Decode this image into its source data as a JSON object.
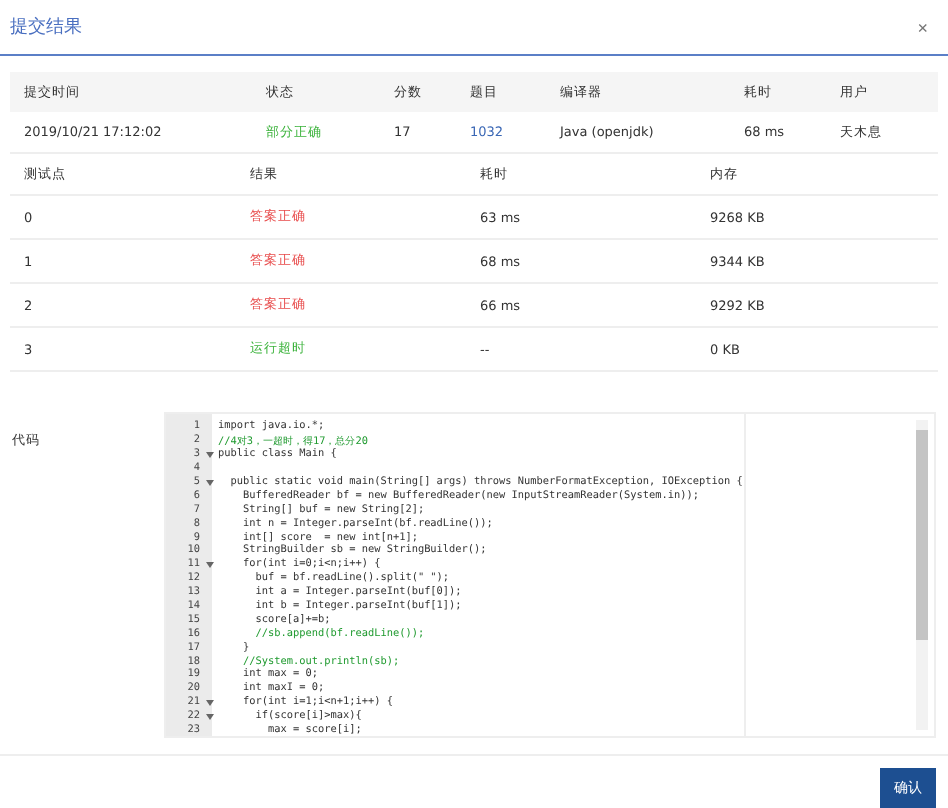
{
  "dialog": {
    "title": "提交结果",
    "close": "×"
  },
  "summary": {
    "columns": [
      "提交时间",
      "状态",
      "分数",
      "题目",
      "编译器",
      "耗时",
      "用户"
    ],
    "row": {
      "time": "2019/10/21 17:12:02",
      "status": "部分正确",
      "color": "#3cb33c",
      "score": "17",
      "problem": "1032",
      "compiler": "Java (openjdk)",
      "elapsed": "68 ms",
      "user": "天木息"
    }
  },
  "tests": {
    "columns": [
      "测试点",
      "结果",
      "耗时",
      "内存"
    ],
    "rows": [
      {
        "id": "0",
        "result": "答案正确",
        "color": "#e84c4c",
        "time": "63 ms",
        "memory": "9268 KB"
      },
      {
        "id": "1",
        "result": "答案正确",
        "color": "#e84c4c",
        "time": "68 ms",
        "memory": "9344 KB"
      },
      {
        "id": "2",
        "result": "答案正确",
        "color": "#e84c4c",
        "time": "66 ms",
        "memory": "9292 KB"
      },
      {
        "id": "3",
        "result": "运行超时",
        "color": "#3cb33c",
        "time": "--",
        "memory": "0 KB"
      }
    ]
  },
  "code": {
    "label": "代码",
    "lines": [
      {
        "number": "1",
        "fold": false,
        "comment": false,
        "text": "import java.io.*;"
      },
      {
        "number": "2",
        "fold": false,
        "comment": true,
        "text": "//4对3，一超时，得17，总分20"
      },
      {
        "number": "3",
        "fold": true,
        "comment": false,
        "text": "public class Main {"
      },
      {
        "number": "4",
        "fold": false
      },
      {
        "number": "5",
        "fold": true,
        "comment": false,
        "text": "  public static void main(String[] args) throws NumberFormatException, IOException {"
      },
      {
        "number": "6",
        "fold": false,
        "comment": false,
        "text": "    BufferedReader bf = new BufferedReader(new InputStreamReader(System.in));"
      },
      {
        "number": "7",
        "fold": false,
        "comment": false,
        "text": "    String[] buf = new String[2];"
      },
      {
        "number": "8",
        "fold": false,
        "comment": false,
        "text": "    int n = Integer.parseInt(bf.readLine());"
      },
      {
        "number": "9",
        "fold": false,
        "comment": false,
        "text": "    int[] score  = new int[n+1];"
      },
      {
        "number": "10",
        "fold": false,
        "comment": false,
        "text": "    StringBuilder sb = new StringBuilder();"
      },
      {
        "number": "11",
        "fold": true,
        "comment": false,
        "text": "    for(int i=0;i<n;i++) {"
      },
      {
        "number": "12",
        "fold": false,
        "comment": false,
        "text": "      buf = bf.readLine().split(\" \");"
      },
      {
        "number": "13",
        "fold": false,
        "comment": false,
        "text": "      int a = Integer.parseInt(buf[0]);"
      },
      {
        "number": "14",
        "fold": false,
        "comment": false,
        "text": "      int b = Integer.parseInt(buf[1]);"
      },
      {
        "number": "15",
        "fold": false,
        "comment": false,
        "text": "      score[a]+=b;"
      },
      {
        "number": "16",
        "fold": false,
        "comment": true,
        "text": "      //sb.append(bf.readLine());"
      },
      {
        "number": "17",
        "fold": false,
        "comment": false,
        "text": "    }"
      },
      {
        "number": "18",
        "fold": false,
        "comment": true,
        "text": "    //System.out.println(sb);"
      },
      {
        "number": "19",
        "fold": false,
        "comment": false,
        "text": "    int max = 0;"
      },
      {
        "number": "20",
        "fold": false,
        "comment": false,
        "text": "    int maxI = 0;"
      },
      {
        "number": "21",
        "fold": true,
        "comment": false,
        "text": "    for(int i=1;i<n+1;i++) {"
      },
      {
        "number": "22",
        "fold": true,
        "comment": false,
        "text": "      if(score[i]>max){"
      },
      {
        "number": "23",
        "fold": false,
        "comment": false,
        "text": "        max = score[i];"
      }
    ]
  },
  "confirm_button": "确认"
}
